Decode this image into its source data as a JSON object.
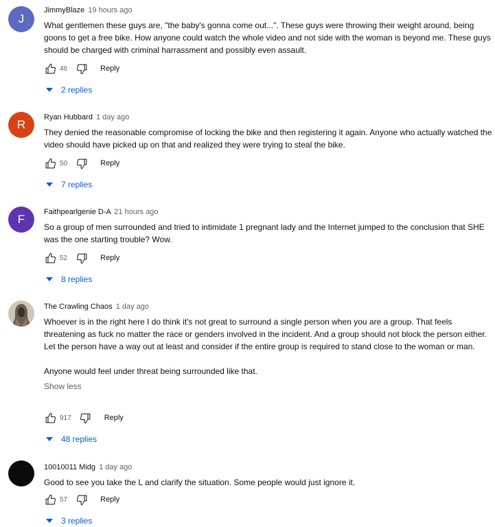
{
  "comments": [
    {
      "author": "JimmyBlaze",
      "time": "19 hours ago",
      "avatar_letter": "J",
      "avatar_color": "#5c6bc0",
      "paragraphs": [
        "What gentlemen these guys are, \"the baby's gonna come out...\".  These guys were throwing their weight around, being goons to get a free bike.  How anyone could watch the whole video and not side with the woman is beyond me.  These guys should be charged with criminal harrassment and possibly even assault."
      ],
      "likes": "46",
      "reply_label": "Reply",
      "replies_label": "2 replies"
    },
    {
      "author": "Ryan Hubbard",
      "time": "1 day ago",
      "avatar_letter": "R",
      "avatar_color": "#d84315",
      "paragraphs": [
        "They denied the reasonable compromise of locking the bike and then registering it again. Anyone who actually watched the video should have picked up on that and realized they were trying to steal the bike."
      ],
      "likes": "50",
      "reply_label": "Reply",
      "replies_label": "7 replies"
    },
    {
      "author": "Faithpearlgenie D-A",
      "time": "21 hours ago",
      "avatar_letter": "F",
      "avatar_color": "#5e35b1",
      "paragraphs": [
        "So a group of men surrounded and tried to intimidate 1 pregnant lady and the Internet jumped to the conclusion that SHE was the one starting trouble? Wow."
      ],
      "likes": "52",
      "reply_label": "Reply",
      "replies_label": "8 replies"
    },
    {
      "author": "The Crawling Chaos",
      "time": "1 day ago",
      "avatar_letter": "",
      "avatar_color": "#8a7f74",
      "paragraphs": [
        "Whoever is in the right here I do think it's not great to surround a single person when you are a group. That feels threatening as fuck no matter the race or genders involved in the incident. And a group should not block the person either. Let the person have a way out at least and consider if the entire group is required to stand close to the woman or man.",
        "Anyone would feel under threat being surrounded like that."
      ],
      "show_less": "Show less",
      "likes": "917",
      "reply_label": "Reply",
      "replies_label": "48 replies"
    },
    {
      "author": "10010011 Midg",
      "time": "1 day ago",
      "avatar_letter": "",
      "avatar_color": "#0a0a0a",
      "paragraphs": [
        "Good to see you take the L and clarify the situation. Some people would just ignore it."
      ],
      "likes": "57",
      "reply_label": "Reply",
      "replies_label": "3 replies"
    }
  ]
}
